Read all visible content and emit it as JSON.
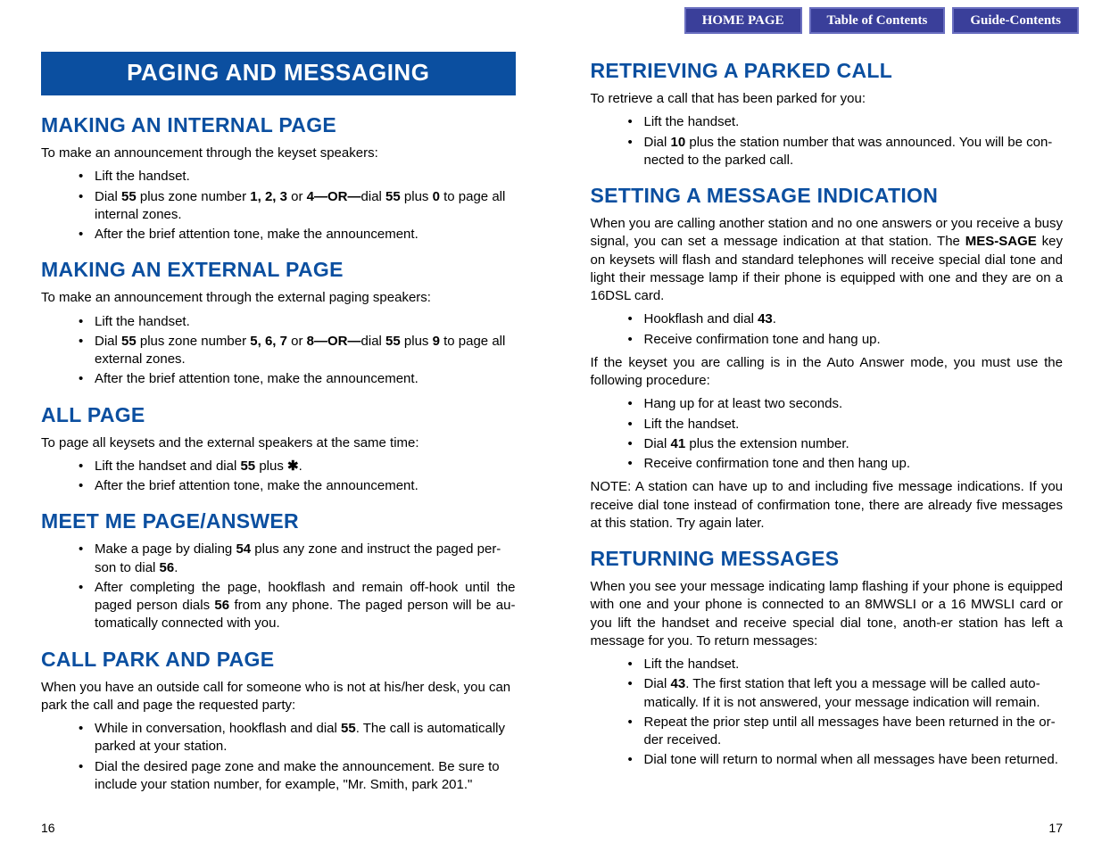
{
  "nav": {
    "home": "HOME PAGE",
    "toc": "Table of Contents",
    "guide": "Guide-Contents"
  },
  "left": {
    "title": "PAGING AND MESSAGING",
    "s1": {
      "h": "MAKING AN INTERNAL PAGE",
      "p": "To make an announcement through the keyset speakers:",
      "li1": "Lift the handset.",
      "li2a": "Dial ",
      "li2b": "55",
      "li2c": " plus zone number ",
      "li2d": "1, 2, 3",
      "li2e": " or ",
      "li2f": "4—OR—",
      "li2g": "dial ",
      "li2h": "55",
      "li2i": " plus ",
      "li2j": "0",
      "li2k": " to page all internal zones.",
      "li3": "After the brief attention tone, make the announcement."
    },
    "s2": {
      "h": "MAKING AN EXTERNAL PAGE",
      "p": "To make an announcement through the external paging speakers:",
      "li1": "Lift the handset.",
      "li2a": "Dial ",
      "li2b": "55",
      "li2c": " plus zone number ",
      "li2d": "5, 6, 7",
      "li2e": " or ",
      "li2f": "8—OR—",
      "li2g": "dial ",
      "li2h": "55",
      "li2i": " plus ",
      "li2j": "9",
      "li2k": " to page all external zones.",
      "li3": "After the brief attention tone, make the announcement."
    },
    "s3": {
      "h": "ALL PAGE",
      "p": "To page all keysets and the external speakers at the same time:",
      "li1a": "Lift the handset and dial ",
      "li1b": "55",
      "li1c": " plus ",
      "li1d": "✱",
      "li1e": ".",
      "li2": "After the brief attention tone, make the announcement."
    },
    "s4": {
      "h": "MEET ME PAGE/ANSWER",
      "li1a": "Make a page by dialing ",
      "li1b": "54",
      "li1c": " plus any zone and instruct the paged per-son to dial ",
      "li1d": "56",
      "li1e": ".",
      "li2a": "After completing the page, hookflash and remain off-hook until the paged person dials ",
      "li2b": "56",
      "li2c": " from any phone. The paged person will be au-tomatically connected with you."
    },
    "s5": {
      "h": "CALL PARK AND PAGE",
      "p": "When you have an outside call for someone who is not at his/her desk, you can park the call and page the requested party:",
      "li1a": "While in conversation, hookflash and dial ",
      "li1b": "55",
      "li1c": ". The call is automatically parked at your station.",
      "li2": "Dial the desired page zone and make the announcement. Be sure to include your station number, for example, \"Mr. Smith, park 201.\""
    },
    "page": "16"
  },
  "right": {
    "s1": {
      "h": "RETRIEVING A PARKED CALL",
      "p": "To retrieve a call that has been parked for you:",
      "li1": "Lift the handset.",
      "li2a": "Dial ",
      "li2b": "10",
      "li2c": " plus the station number that was announced. You will be con-nected to the parked call."
    },
    "s2": {
      "h": "SETTING A MESSAGE INDICATION",
      "p1a": "When you are calling another station and no one answers or you receive a busy signal, you can set a message indication at that station. The ",
      "p1b": "MES-SAGE",
      "p1c": " key on keysets will flash and standard telephones will receive special dial tone and light their message lamp if their phone is equipped with one and they are on a 16DSL card.",
      "li1a": "Hookflash and dial ",
      "li1b": "43",
      "li1c": ".",
      "li2": "Receive confirmation tone and hang up.",
      "p2": "If the keyset you are calling is in the Auto Answer mode, you must use the following procedure:",
      "li3": "Hang up for at least two seconds.",
      "li4": "Lift the handset.",
      "li5a": "Dial ",
      "li5b": "41",
      "li5c": " plus the extension number.",
      "li6": "Receive confirmation tone and then hang up.",
      "p3": "NOTE: A station can have up to and including five message indications. If you receive dial tone instead of confirmation tone, there are already five messages at this station. Try again later."
    },
    "s3": {
      "h": "RETURNING MESSAGES",
      "p": "When you see your message indicating lamp flashing if your phone is equipped with one and your phone is connected to an 8MWSLI or a 16 MWSLI card or you lift the handset and receive special dial tone, anoth-er station has left a message for you. To return messages:",
      "li1": "Lift the handset.",
      "li2a": "Dial ",
      "li2b": "43",
      "li2c": ". The first station that left you a message will be called auto-matically. If it is not answered, your message indication will remain.",
      "li3": "Repeat the prior step until all messages have been returned in the or-der received.",
      "li4": "Dial tone will return to normal when all messages have been returned."
    },
    "page": "17"
  }
}
